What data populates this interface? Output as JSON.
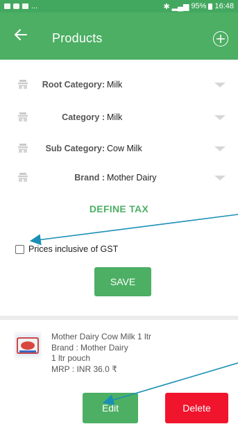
{
  "status_bar": {
    "left_text": "...",
    "right_text": "95%",
    "time": "16:48"
  },
  "app_bar": {
    "title": "Products",
    "back_icon": "arrow-left-icon",
    "add_icon": "plus-circle-icon"
  },
  "form": {
    "rows": [
      {
        "label": "Root Category:",
        "value": "Milk",
        "icon": "building-icon"
      },
      {
        "label": "Category :",
        "value": "Milk",
        "icon": "building-icon"
      },
      {
        "label": "Sub Category:",
        "value": "Cow Milk",
        "icon": "building-icon"
      },
      {
        "label": "Brand :",
        "value": "Mother Dairy",
        "icon": "building-icon"
      }
    ],
    "define_tax": "DEFINE TAX",
    "gst_label": "Prices inclusive of GST",
    "gst_checked": false,
    "save_label": "SAVE"
  },
  "product": {
    "name": "Mother Dairy Cow Milk 1 ltr",
    "brand": "Brand : Mother Dairy",
    "pack": "1 ltr pouch",
    "mrp": "MRP : INR 36.0 ₹",
    "edit_label": "Edit",
    "delete_label": "Delete"
  },
  "colors": {
    "status_bar": "#43a85f",
    "primary": "#4caf64",
    "delete": "#f0142c",
    "annotation_arrow": "#1a8fb5"
  }
}
